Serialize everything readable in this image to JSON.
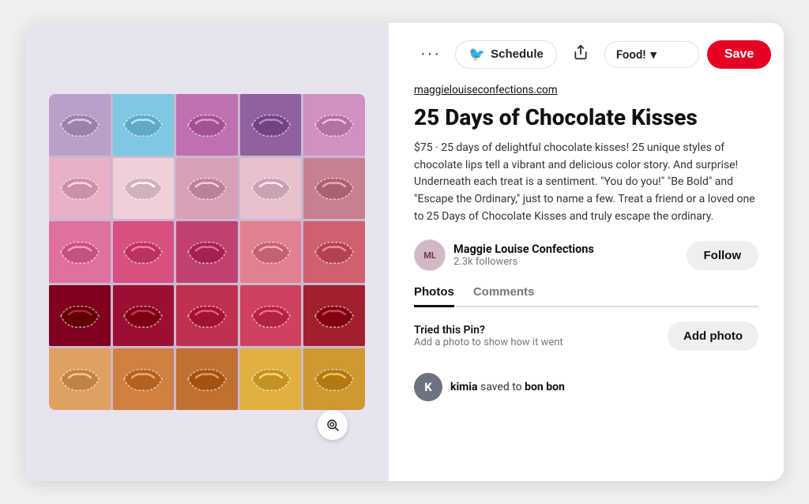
{
  "toolbar": {
    "more_label": "···",
    "schedule_label": "Schedule",
    "share_icon": "↑",
    "board_name": "Food!",
    "chevron": "▾",
    "save_label": "Save"
  },
  "pin": {
    "source_url": "maggielouiseconfections.com",
    "title": "25 Days of Chocolate Kisses",
    "description": "$75 · 25 days of delightful chocolate kisses! 25 unique styles of chocolate lips tell a vibrant and delicious color story. And surprise! Underneath each treat is a sentiment. \"You do you!\" \"Be Bold\" and \"Escape the Ordinary,\" just to name a few. Treat a friend or a loved one to 25 Days of Chocolate Kisses and truly escape the ordinary."
  },
  "author": {
    "name": "Maggie Louise Confections",
    "followers": "2.3k followers",
    "follow_label": "Follow",
    "avatar_initials": "ML"
  },
  "tabs": [
    {
      "label": "Photos",
      "active": true
    },
    {
      "label": "Comments",
      "active": false
    }
  ],
  "add_photo": {
    "tried_text": "Tried this Pin?",
    "sub_text": "Add a photo to show how it went",
    "button_label": "Add photo"
  },
  "saved_by": {
    "avatar_letter": "K",
    "username": "kimia",
    "action": "saved to",
    "board": "bon bon"
  },
  "lip_grid": [
    {
      "color": "#b8a0c8"
    },
    {
      "color": "#7ec8e3"
    },
    {
      "color": "#c070b0"
    },
    {
      "color": "#9060a0"
    },
    {
      "color": "#d090c0"
    },
    {
      "color": "#e8b0c8"
    },
    {
      "color": "#f0d0d8"
    },
    {
      "color": "#d8a0b8"
    },
    {
      "color": "#e8c0d0"
    },
    {
      "color": "#c88090"
    },
    {
      "color": "#e070a0"
    },
    {
      "color": "#d85080"
    },
    {
      "color": "#c04070"
    },
    {
      "color": "#e08090"
    },
    {
      "color": "#d06070"
    },
    {
      "color": "#800020"
    },
    {
      "color": "#9b1030"
    },
    {
      "color": "#c03050"
    },
    {
      "color": "#d04060"
    },
    {
      "color": "#a02030"
    },
    {
      "color": "#e0a060"
    },
    {
      "color": "#d08040"
    },
    {
      "color": "#c07030"
    },
    {
      "color": "#e0b040"
    },
    {
      "color": "#d09830"
    }
  ]
}
